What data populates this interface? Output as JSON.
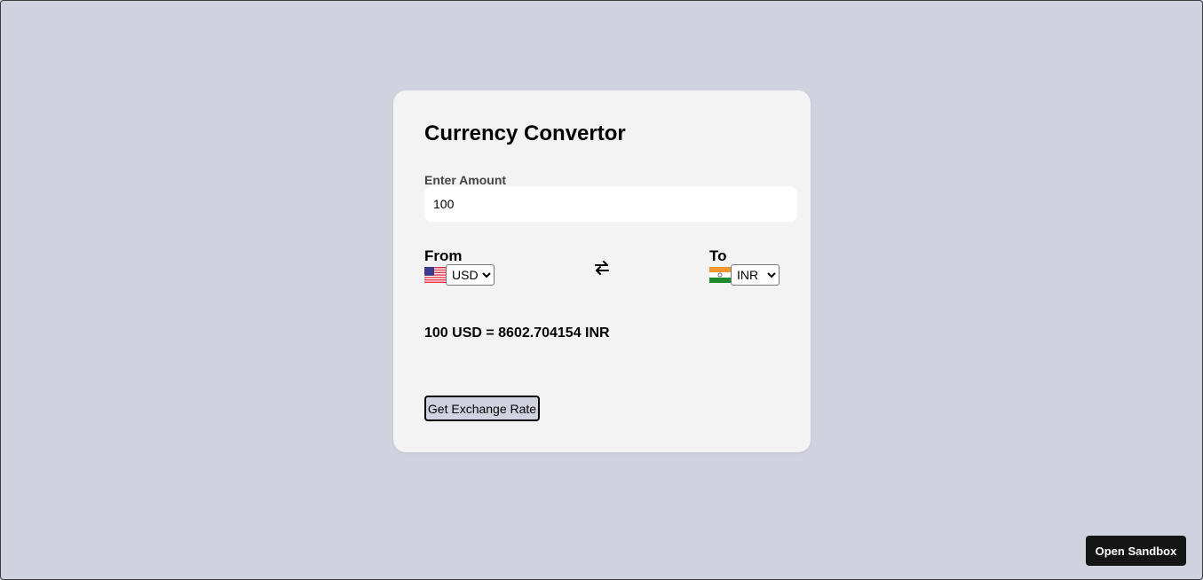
{
  "converter": {
    "title": "Currency Convertor",
    "amount_label": "Enter Amount",
    "amount_value": "100",
    "from_label": "From",
    "to_label": "To",
    "from_currency": {
      "selected": "USD",
      "flag_icon": "us-flag-icon",
      "options": [
        "USD"
      ]
    },
    "to_currency": {
      "selected": "INR",
      "flag_icon": "india-flag-icon",
      "options": [
        "INR"
      ]
    },
    "swap_icon": "swap-arrows-icon",
    "result_text": "100 USD = 8602.704154 INR",
    "button_label": "Get Exchange Rate"
  },
  "sandbox": {
    "button_label": "Open Sandbox"
  },
  "colors": {
    "page_background": "#d0d2e0",
    "card_background": "#f3f3f3",
    "button_background": "#d0d2e0",
    "sandbox_button": "#151515"
  }
}
